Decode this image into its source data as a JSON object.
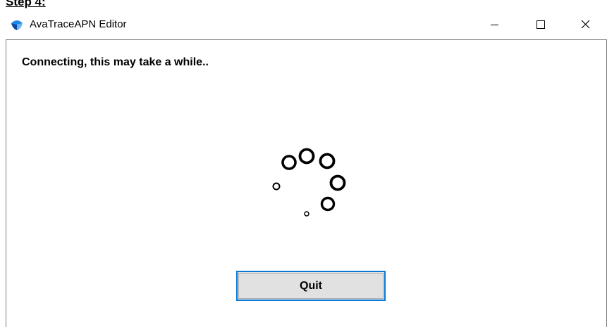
{
  "step_label": "Step 4:",
  "window": {
    "title": "AvaTraceAPN Editor",
    "app_icon": "avatrace-app-icon",
    "controls": {
      "minimize_icon": "minimize-icon",
      "maximize_icon": "maximize-icon",
      "close_icon": "close-icon"
    }
  },
  "content": {
    "status_text": "Connecting, this may take a while..",
    "spinner_icon": "loading-spinner-icon",
    "quit_label": "Quit"
  },
  "colors": {
    "button_focus_border": "#0a78d7",
    "button_background": "#e1e1e1",
    "app_icon_blue": "#1e88e5"
  }
}
